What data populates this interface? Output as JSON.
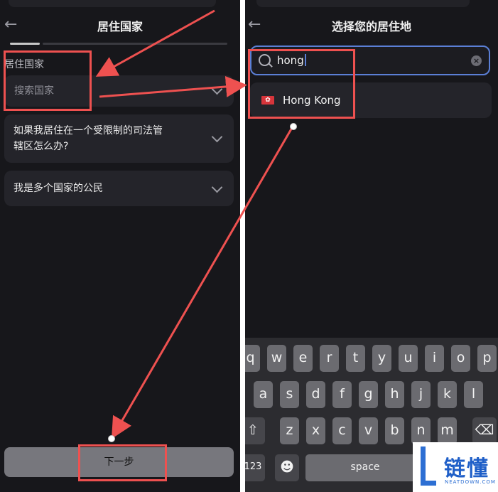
{
  "left_screen": {
    "title": "居住国家",
    "back_icon": "arrow-left-icon",
    "field_label": "居住国家",
    "search_placeholder": "搜索国家",
    "faq": [
      {
        "line1": "如果我居住在一个受限制的司法管",
        "line2": "辖区怎么办?"
      },
      {
        "line1": "我是多个国家的公民",
        "line2": ""
      }
    ],
    "next_button": "下一步"
  },
  "right_screen": {
    "title": "选择您的居住地",
    "back_icon": "arrow-left-icon",
    "search_value": "hong",
    "result": {
      "flag_icon": "hong-kong-flag-icon",
      "label": "Hong Kong"
    },
    "keyboard": {
      "row1": [
        "q",
        "w",
        "e",
        "r",
        "t",
        "y",
        "u",
        "i",
        "o",
        "p"
      ],
      "row2": [
        "a",
        "s",
        "d",
        "f",
        "g",
        "h",
        "j",
        "k",
        "l"
      ],
      "row3": [
        "z",
        "x",
        "c",
        "v",
        "b",
        "n",
        "m"
      ],
      "shift": "⇧",
      "delete": "⌫",
      "numbers": "123",
      "emoji": "☻",
      "space": "space"
    }
  },
  "annotation_color": "#ee5150",
  "watermark": {
    "text": "链懂",
    "sub": "NEATDOWN.COM"
  }
}
